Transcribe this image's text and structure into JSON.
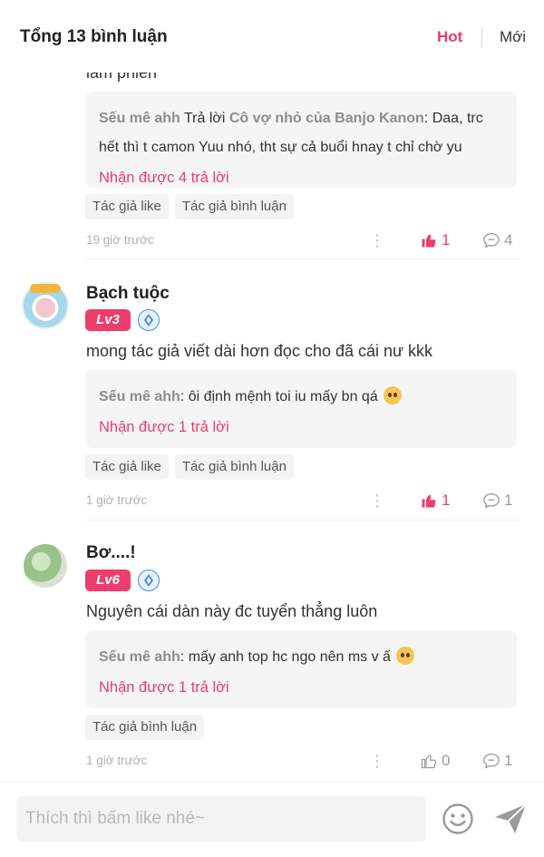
{
  "header": {
    "title": "Tổng 13 bình luận",
    "sort_hot": "Hot",
    "sort_new": "Mới"
  },
  "colors": {
    "accent": "#ec3d6c",
    "level_badge_blue": "#3b8ee6"
  },
  "comments": [
    {
      "text_partial": "làm phiền",
      "reply": {
        "author": "Sếu mê ahh",
        "reply_word": "Trả lời",
        "reply_to": "Cô vợ nhỏ của Banjo Kanon",
        "line1": ": Daa, trc",
        "line2": "hết thì t camon Yuu nhó, tht sự cả buổi hnay t chỉ chờ yu",
        "count_label": "Nhận được 4 trả lời"
      },
      "tags": [
        "Tác giả like",
        "Tác giả bình luận"
      ],
      "time": "19 giờ trước",
      "likes": "1",
      "liked": true,
      "replies": "4"
    },
    {
      "author": "Bạch tuộc",
      "level": "Lv3",
      "text": "mong tác giả viết dài hơn đọc cho đã cái nư kkk",
      "reply": {
        "author": "Sếu mê ahh",
        "body": ": ôi định mệnh toi iu mấy bn qá",
        "emoji": "pleading-face-emoji",
        "count_label": "Nhận được 1 trả lời"
      },
      "tags": [
        "Tác giả like",
        "Tác giả bình luận"
      ],
      "time": "1 giờ trước",
      "likes": "1",
      "liked": true,
      "replies": "1"
    },
    {
      "author": "Bơ....!",
      "level": "Lv6",
      "text": "Nguyên cái dàn này đc tuyển thẳng luôn",
      "reply": {
        "author": "Sếu mê ahh",
        "body": ": mấy anh top hc ngo nên ms v ấ",
        "emoji": "savoring-face-emoji",
        "count_label": "Nhận được 1 trả lời"
      },
      "tags": [
        "Tác giả bình luận"
      ],
      "time": "1 giờ trước",
      "likes": "0",
      "liked": false,
      "replies": "1"
    }
  ],
  "footer": {
    "placeholder": "Thích thì bấm like nhé~",
    "emoji_icon": "smiley-icon",
    "send_icon": "send-icon"
  }
}
